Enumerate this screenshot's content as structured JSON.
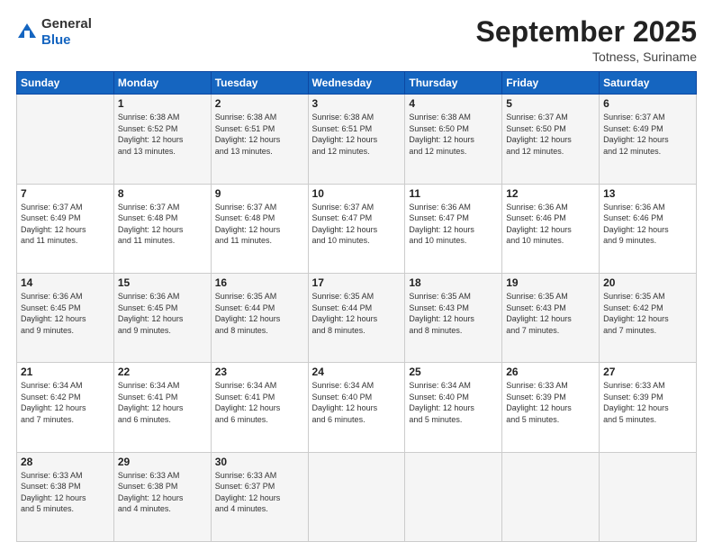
{
  "header": {
    "logo_general": "General",
    "logo_blue": "Blue",
    "month_title": "September 2025",
    "location": "Totness, Suriname"
  },
  "days_of_week": [
    "Sunday",
    "Monday",
    "Tuesday",
    "Wednesday",
    "Thursday",
    "Friday",
    "Saturday"
  ],
  "weeks": [
    [
      {
        "day": "",
        "info": ""
      },
      {
        "day": "1",
        "info": "Sunrise: 6:38 AM\nSunset: 6:52 PM\nDaylight: 12 hours\nand 13 minutes."
      },
      {
        "day": "2",
        "info": "Sunrise: 6:38 AM\nSunset: 6:51 PM\nDaylight: 12 hours\nand 13 minutes."
      },
      {
        "day": "3",
        "info": "Sunrise: 6:38 AM\nSunset: 6:51 PM\nDaylight: 12 hours\nand 12 minutes."
      },
      {
        "day": "4",
        "info": "Sunrise: 6:38 AM\nSunset: 6:50 PM\nDaylight: 12 hours\nand 12 minutes."
      },
      {
        "day": "5",
        "info": "Sunrise: 6:37 AM\nSunset: 6:50 PM\nDaylight: 12 hours\nand 12 minutes."
      },
      {
        "day": "6",
        "info": "Sunrise: 6:37 AM\nSunset: 6:49 PM\nDaylight: 12 hours\nand 12 minutes."
      }
    ],
    [
      {
        "day": "7",
        "info": ""
      },
      {
        "day": "8",
        "info": "Sunrise: 6:37 AM\nSunset: 6:48 PM\nDaylight: 12 hours\nand 11 minutes."
      },
      {
        "day": "9",
        "info": "Sunrise: 6:37 AM\nSunset: 6:48 PM\nDaylight: 12 hours\nand 11 minutes."
      },
      {
        "day": "10",
        "info": "Sunrise: 6:37 AM\nSunset: 6:47 PM\nDaylight: 12 hours\nand 10 minutes."
      },
      {
        "day": "11",
        "info": "Sunrise: 6:36 AM\nSunset: 6:47 PM\nDaylight: 12 hours\nand 10 minutes."
      },
      {
        "day": "12",
        "info": "Sunrise: 6:36 AM\nSunset: 6:46 PM\nDaylight: 12 hours\nand 10 minutes."
      },
      {
        "day": "13",
        "info": "Sunrise: 6:36 AM\nSunset: 6:46 PM\nDaylight: 12 hours\nand 9 minutes."
      }
    ],
    [
      {
        "day": "14",
        "info": ""
      },
      {
        "day": "15",
        "info": "Sunrise: 6:36 AM\nSunset: 6:45 PM\nDaylight: 12 hours\nand 9 minutes."
      },
      {
        "day": "16",
        "info": "Sunrise: 6:35 AM\nSunset: 6:44 PM\nDaylight: 12 hours\nand 8 minutes."
      },
      {
        "day": "17",
        "info": "Sunrise: 6:35 AM\nSunset: 6:44 PM\nDaylight: 12 hours\nand 8 minutes."
      },
      {
        "day": "18",
        "info": "Sunrise: 6:35 AM\nSunset: 6:43 PM\nDaylight: 12 hours\nand 8 minutes."
      },
      {
        "day": "19",
        "info": "Sunrise: 6:35 AM\nSunset: 6:43 PM\nDaylight: 12 hours\nand 7 minutes."
      },
      {
        "day": "20",
        "info": "Sunrise: 6:35 AM\nSunset: 6:42 PM\nDaylight: 12 hours\nand 7 minutes."
      }
    ],
    [
      {
        "day": "21",
        "info": ""
      },
      {
        "day": "22",
        "info": "Sunrise: 6:34 AM\nSunset: 6:41 PM\nDaylight: 12 hours\nand 6 minutes."
      },
      {
        "day": "23",
        "info": "Sunrise: 6:34 AM\nSunset: 6:41 PM\nDaylight: 12 hours\nand 6 minutes."
      },
      {
        "day": "24",
        "info": "Sunrise: 6:34 AM\nSunset: 6:40 PM\nDaylight: 12 hours\nand 6 minutes."
      },
      {
        "day": "25",
        "info": "Sunrise: 6:34 AM\nSunset: 6:40 PM\nDaylight: 12 hours\nand 5 minutes."
      },
      {
        "day": "26",
        "info": "Sunrise: 6:33 AM\nSunset: 6:39 PM\nDaylight: 12 hours\nand 5 minutes."
      },
      {
        "day": "27",
        "info": "Sunrise: 6:33 AM\nSunset: 6:39 PM\nDaylight: 12 hours\nand 5 minutes."
      }
    ],
    [
      {
        "day": "28",
        "info": "Sunrise: 6:33 AM\nSunset: 6:38 PM\nDaylight: 12 hours\nand 5 minutes."
      },
      {
        "day": "29",
        "info": "Sunrise: 6:33 AM\nSunset: 6:38 PM\nDaylight: 12 hours\nand 4 minutes."
      },
      {
        "day": "30",
        "info": "Sunrise: 6:33 AM\nSunset: 6:37 PM\nDaylight: 12 hours\nand 4 minutes."
      },
      {
        "day": "",
        "info": ""
      },
      {
        "day": "",
        "info": ""
      },
      {
        "day": "",
        "info": ""
      },
      {
        "day": "",
        "info": ""
      }
    ]
  ],
  "week7_sun_info": "Sunrise: 6:37 AM\nSunset: 6:49 PM\nDaylight: 12 hours\nand 11 minutes.",
  "week14_sun_info": "Sunrise: 6:36 AM\nSunset: 6:45 PM\nDaylight: 12 hours\nand 9 minutes.",
  "week21_sun_info": "Sunrise: 6:34 AM\nSunset: 6:42 PM\nDaylight: 12 hours\nand 7 minutes."
}
